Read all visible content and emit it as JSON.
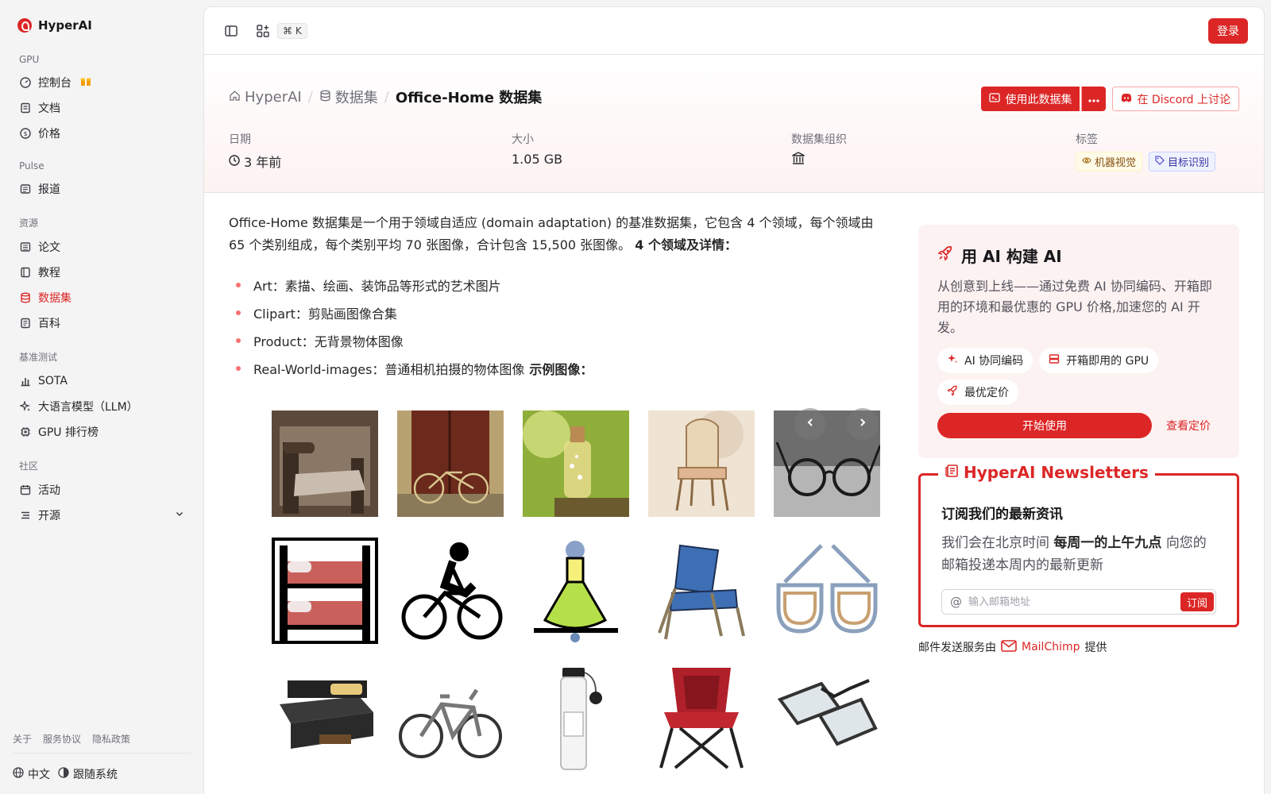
{
  "sidebar": {
    "brand": "HyperAI",
    "sections": {
      "gpu": "GPU",
      "pulse": "Pulse",
      "resources": "资源",
      "benchmark": "基准测试",
      "community": "社区"
    },
    "items": {
      "console": "控制台",
      "docs": "文档",
      "pricing": "价格",
      "news": "报道",
      "papers": "论文",
      "tutorials": "教程",
      "datasets": "数据集",
      "wiki": "百科",
      "sota": "SOTA",
      "llm": "大语言模型（LLM）",
      "gpu_ranking": "GPU 排行榜",
      "events": "活动",
      "open_source": "开源"
    },
    "footer": {
      "about": "关于",
      "terms": "服务协议",
      "privacy": "隐私政策",
      "language": "中文",
      "theme": "跟随系统"
    }
  },
  "topbar": {
    "shortcut": "⌘ K",
    "login": "登录"
  },
  "hero": {
    "breadcrumb": {
      "home": "HyperAI",
      "datasets": "数据集",
      "current": "Office-Home 数据集"
    },
    "actions": {
      "use_dataset": "使用此数据集",
      "discord": "在 Discord 上讨论"
    },
    "meta": {
      "date_label": "日期",
      "date_value": "3 年前",
      "size_label": "大小",
      "size_value": "1.05 GB",
      "org_label": "数据集组织",
      "tags_label": "标签",
      "tags": [
        "机器视觉",
        "目标识别"
      ]
    }
  },
  "content": {
    "intro": "Office-Home 数据集是一个用于领域自适应 (domain adaptation) 的基准数据集，它包含 4 个领域，每个领域由 65 个类别组成，每个类别平均 70 张图像，合计包含 15,500 张图像。",
    "intro_bold": "4 个领域及详情：",
    "domains": [
      "Art：素描、绘画、装饰品等形式的艺术图片",
      "Clipart：剪贴画图像合集",
      "Product：无背景物体图像",
      "Real-World-images：普通相机拍摄的物体图像"
    ],
    "examples_bold": "示例图像："
  },
  "promo": {
    "title": "用 AI 构建 AI",
    "text": "从创意到上线——通过免费 AI 协同编码、开箱即用的环境和最优惠的 GPU 价格,加速您的 AI 开发。",
    "chips": [
      "AI 协同编码",
      "开箱即用的 GPU",
      "最优定价"
    ],
    "start": "开始使用",
    "view_pricing": "查看定价"
  },
  "newsletter": {
    "title": "HyperAI Newsletters",
    "heading": "订阅我们的最新资讯",
    "text_before": "我们会在北京时间",
    "text_bold": "每周一的上午九点",
    "text_after": "向您的邮箱投递本周内的最新更新",
    "placeholder": "输入邮箱地址",
    "subscribe": "订阅",
    "provider_prefix": "邮件发送服务由",
    "provider_name": "MailChimp",
    "provider_suffix": "提供"
  },
  "colors": {
    "accent": "#dc2626"
  }
}
